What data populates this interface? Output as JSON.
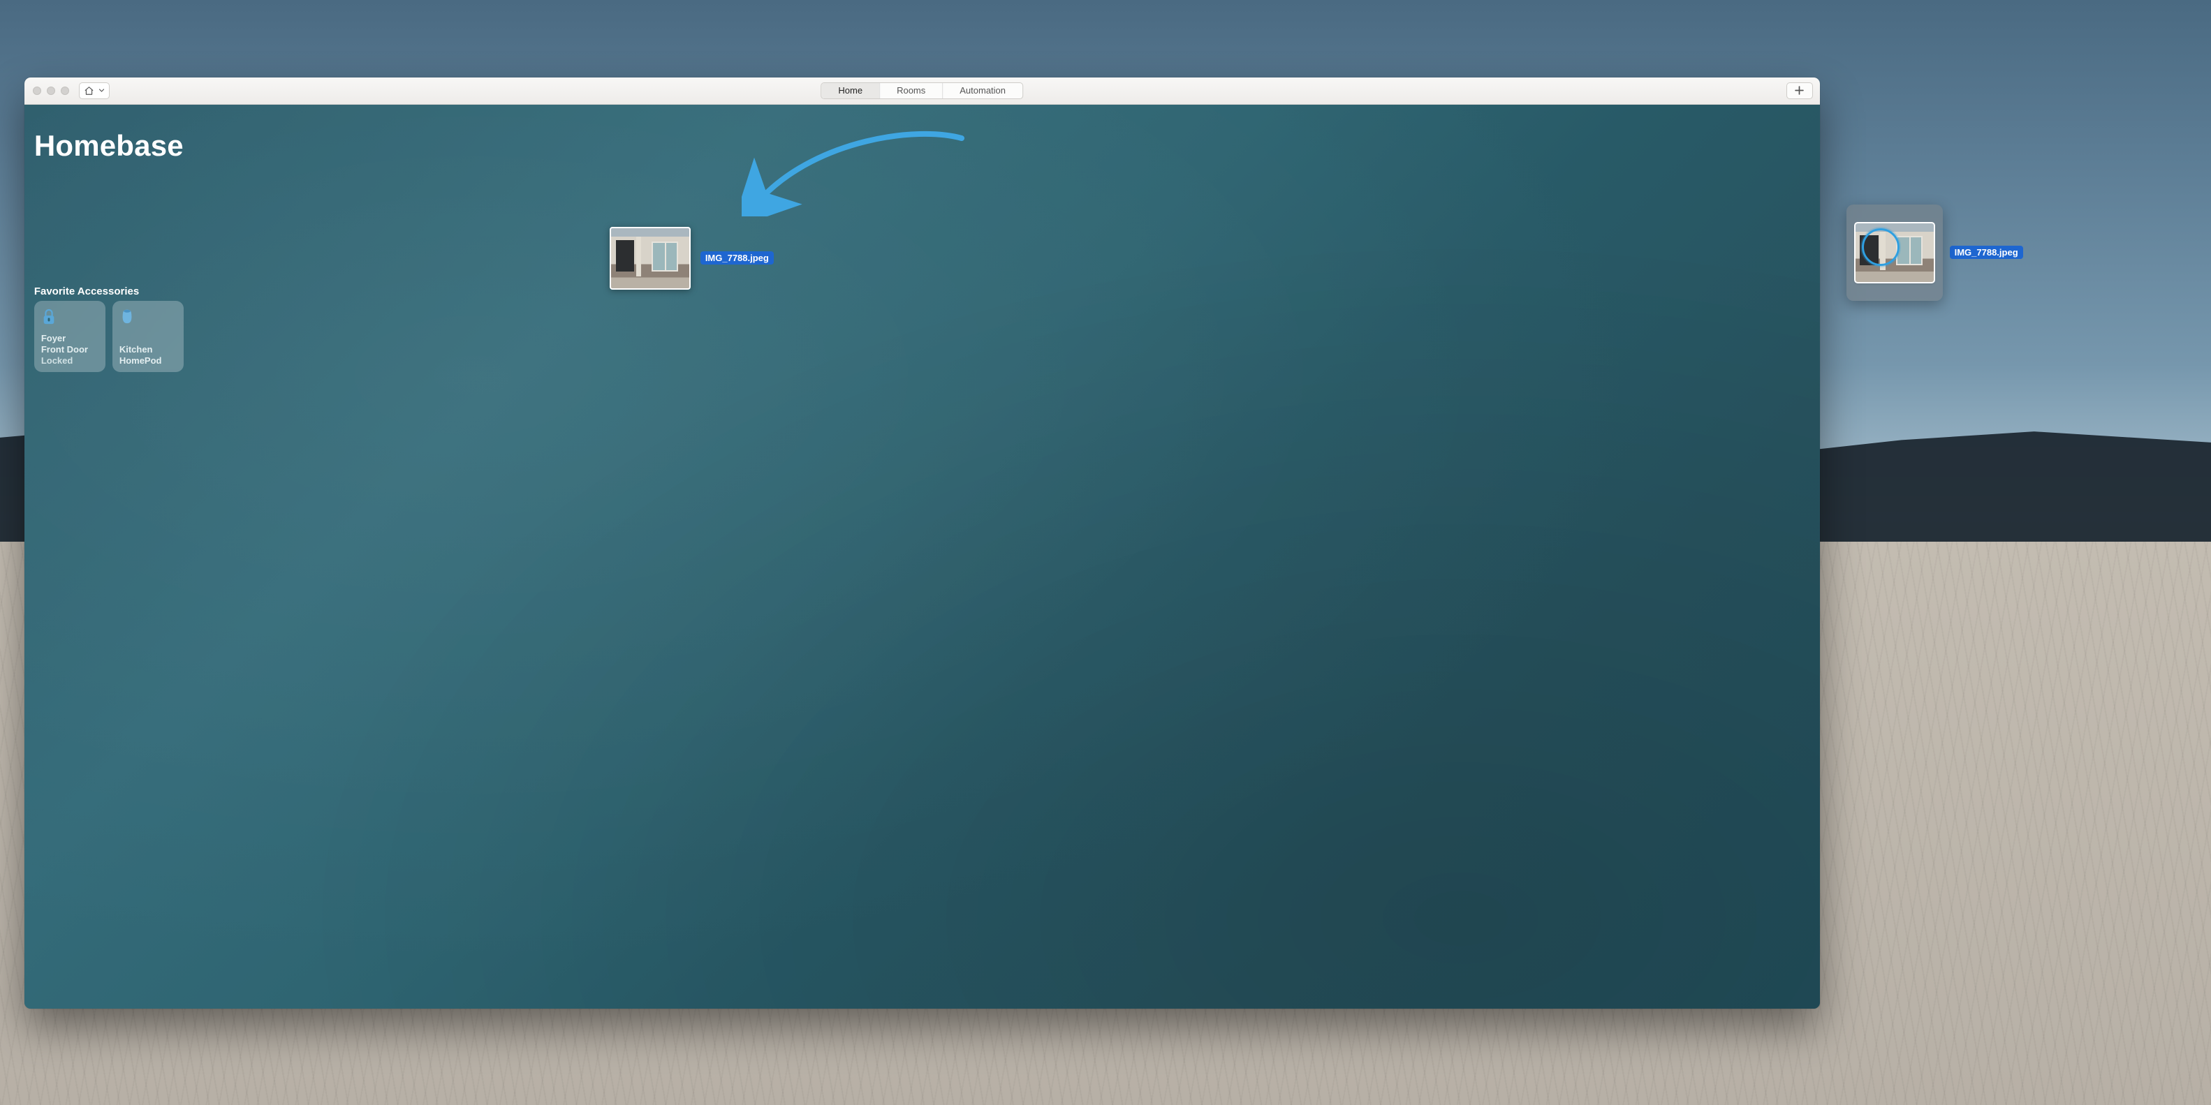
{
  "window": {
    "tabs": [
      {
        "label": "Home",
        "active": true
      },
      {
        "label": "Rooms",
        "active": false
      },
      {
        "label": "Automation",
        "active": false
      }
    ],
    "title": "Homebase",
    "favorites_header": "Favorite Accessories",
    "accessories": [
      {
        "icon": "lock-icon",
        "line1": "Foyer",
        "line2": "Front Door",
        "line3": "Locked"
      },
      {
        "icon": "homepod-icon",
        "line1": "Kitchen",
        "line2": "HomePod",
        "line3": ""
      }
    ]
  },
  "drag": {
    "filename": "IMG_7788.jpeg"
  },
  "desktop_file": {
    "filename": "IMG_7788.jpeg"
  },
  "colors": {
    "accent_blue": "#1e66d0",
    "arrow_blue": "#3fa6e2"
  }
}
